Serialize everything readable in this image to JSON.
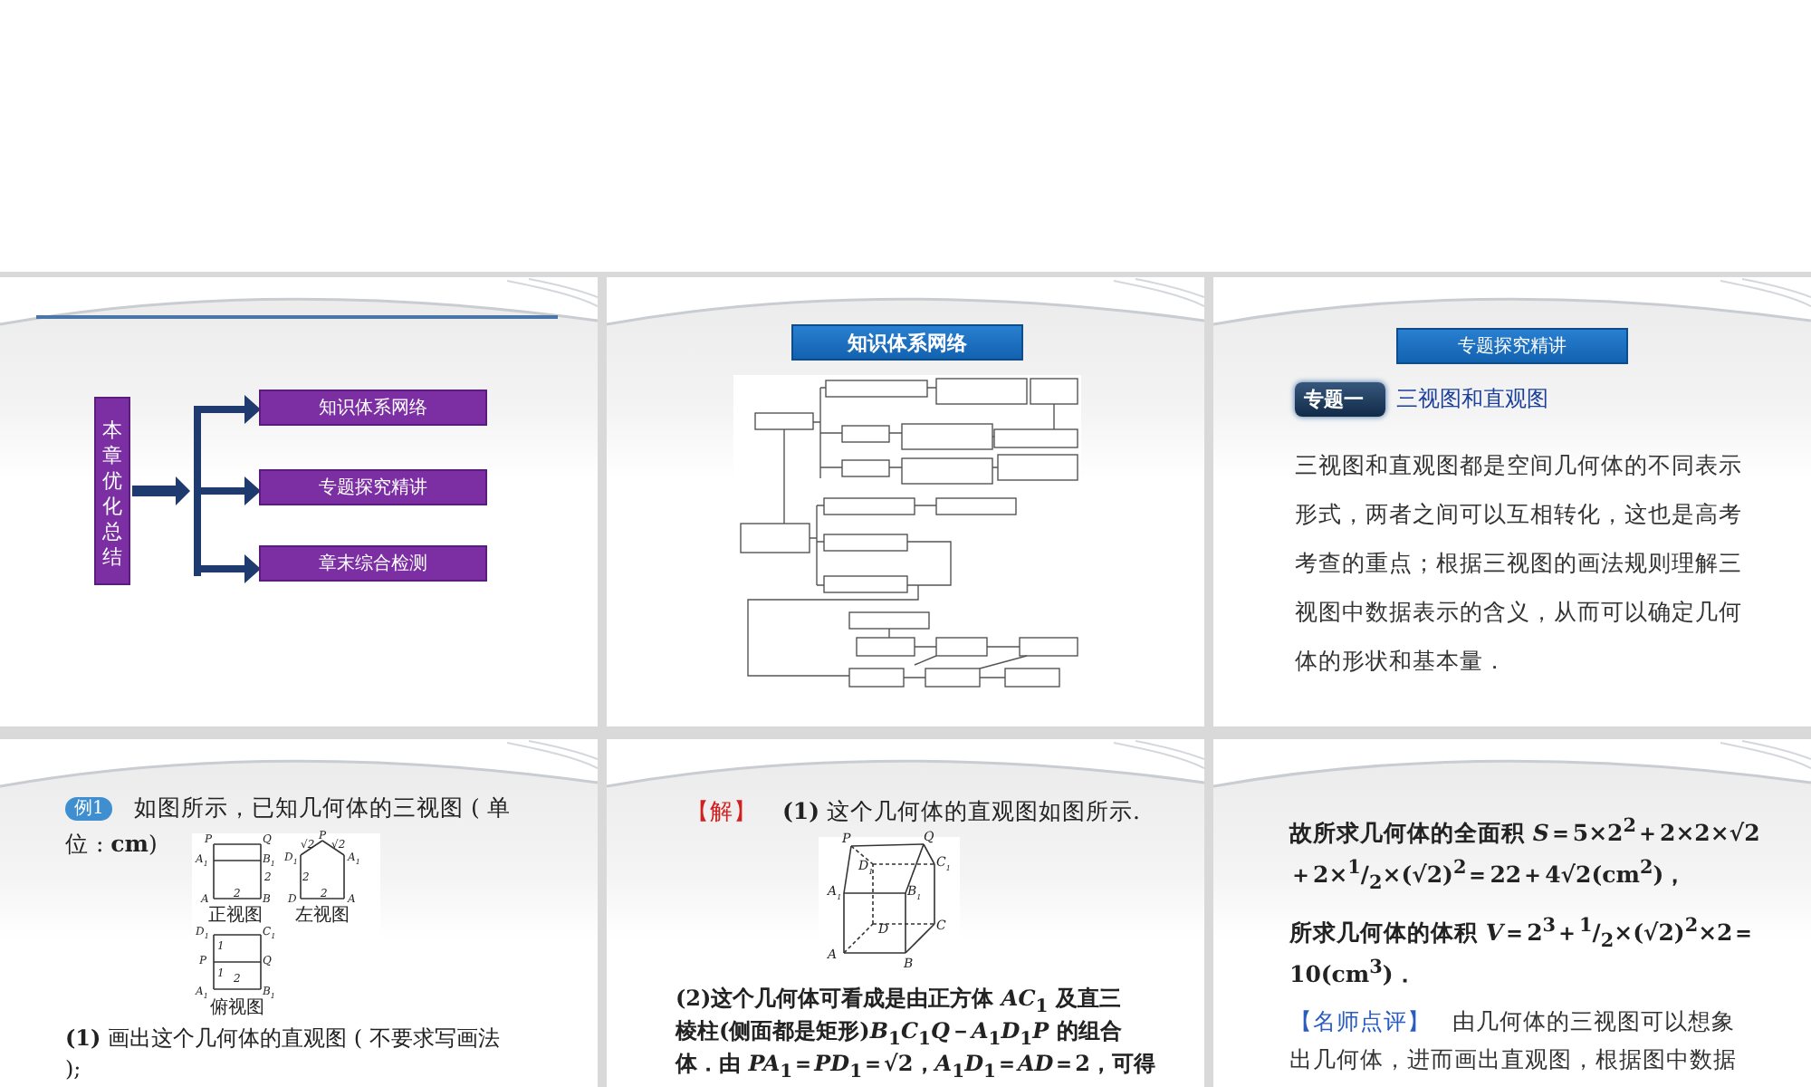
{
  "slides": [
    {
      "kind": "outline",
      "root": "本章优化总结",
      "items": [
        "知识体系网络",
        "专题探究精讲",
        "章末综合检测"
      ]
    },
    {
      "kind": "map",
      "heading": "知识体系网络"
    },
    {
      "kind": "topic",
      "heading": "专题探究精讲",
      "badge": "专题一",
      "title": "三视图和直观图",
      "body": "三视图和直观图都是空间几何体的不同表示形式，两者之间可以互相转化，这也是高考考查的重点；根据三视图的画法规则理解三视图中数据表示的含义，从而可以确定几何体的形状和基本量．"
    },
    {
      "kind": "example",
      "badge": "例1",
      "question": [
        "如图所示，已知几何体的三视图 ( 单",
        "位 : **cm**)"
      ],
      "front_labels": [
        "P",
        "Q",
        "A$_{1}$",
        "B$_{1}$",
        "2",
        "A",
        "2",
        "B"
      ],
      "front_caption": "正视图",
      "left_labels": [
        "√2",
        "P",
        "√2",
        "D$_{1}$",
        "A$_{1}$",
        "2",
        "D",
        "2",
        "A"
      ],
      "left_caption": "左视图",
      "top_labels": [
        "D$_{1}$",
        "C$_{1}$",
        "1",
        "P",
        "Q",
        "1",
        "2",
        "A$_{1}$",
        "B$_{1}$"
      ],
      "top_caption": "俯视图",
      "task": "**(1)** 画出这个几何体的直观图 ( 不要求写画法 );"
    },
    {
      "kind": "solution",
      "label": "【解】",
      "line": "**(1)** 这个几何体的直观图如图所示.",
      "cube_labels": [
        "P",
        "Q",
        "D$_{1}$",
        "C$_{1}$",
        "A$_{1}$",
        "B$_{1}$",
        "D",
        "C",
        "A",
        "B"
      ],
      "text": [
        "(2)这个几何体可看成是由正方体 *AC*$_{1}$ 及直三",
        "棱柱(侧面都是矩形)*B*$_{1}$*C*$_{1}$*Q*－*A*$_{1}$*D*$_{1}$*P* 的组合",
        "体．由 *PA*$_{1}$＝*PD*$_{1}$＝√2，*A*$_{1}$*D*$_{1}$＝*AD*＝2，可得"
      ]
    },
    {
      "kind": "formulas",
      "lines": [
        "故所求几何体的全面积 *S*＝5×2$^{2}$＋2×2×√2",
        "＋2×$^{1}$/$_{2}$×(√2)$^{2}$＝22＋4√2(cm$^{2}$)，",
        "所求几何体的体积 *V*＝2$^{3}$＋$^{1}$/$_{2}$×(√2)$^{2}$×2＝",
        "10(cm$^{3}$)．"
      ],
      "note_label": "【名师点评】",
      "note": [
        "由几何体的三视图可以想象",
        "出几何体，进而画出直观图，根据图中数据"
      ]
    }
  ]
}
